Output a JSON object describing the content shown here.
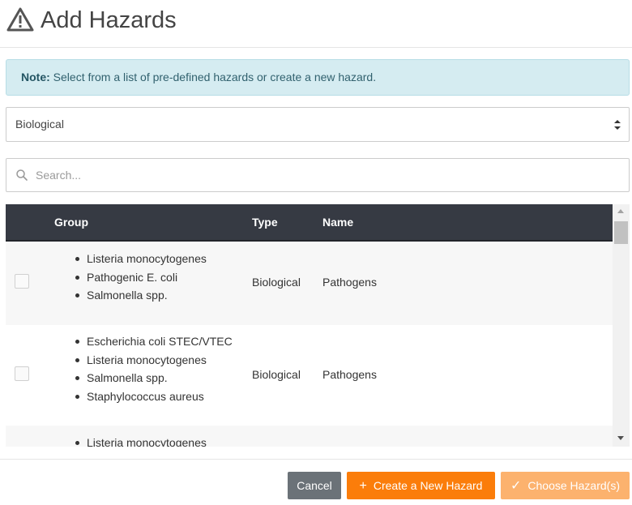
{
  "dialog": {
    "title": "Add Hazards",
    "title_icon": "warning-triangle-icon"
  },
  "note": {
    "label": "Note:",
    "text": " Select from a list of pre-defined hazards or create a new hazard."
  },
  "category_select": {
    "value": "Biological",
    "icon": "select-arrows-icon"
  },
  "search": {
    "placeholder": "Search...",
    "icon": "search-icon"
  },
  "table": {
    "columns": [
      "Group",
      "Type",
      "Name"
    ],
    "rows": [
      {
        "group": [
          "Listeria monocytogenes",
          "Pathogenic E. coli",
          "Salmonella spp."
        ],
        "type": "Biological",
        "name": "Pathogens"
      },
      {
        "group": [
          "Escherichia coli STEC/VTEC",
          "Listeria monocytogenes",
          "Salmonella spp.",
          "Staphylococcus aureus"
        ],
        "type": "Biological",
        "name": "Pathogens"
      },
      {
        "group": [
          "Listeria monocytogenes"
        ],
        "type": "",
        "name": ""
      }
    ]
  },
  "footer": {
    "cancel_label": "Cancel",
    "create_label": "Create a New Hazard",
    "create_icon": "plus-icon",
    "choose_label": "Choose Hazard(s)",
    "choose_icon": "check-icon"
  },
  "colors": {
    "header_bg": "#363a43",
    "note_bg": "#d5ecf1",
    "accent": "#fb7d0a",
    "accent_disabled": "#fcb26e",
    "cancel_bg": "#6b7278"
  }
}
